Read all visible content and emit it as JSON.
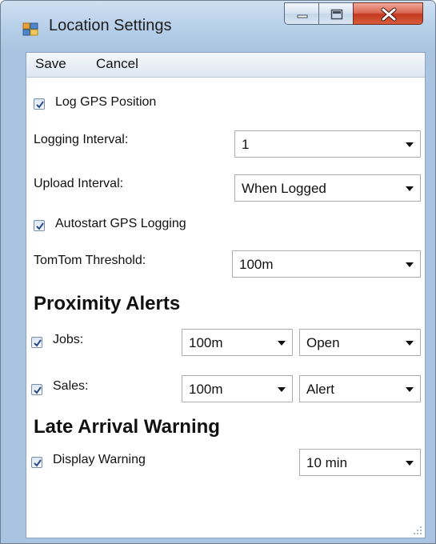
{
  "window": {
    "title": "Location Settings"
  },
  "menu": {
    "save": "Save",
    "cancel": "Cancel"
  },
  "form": {
    "log_gps": {
      "label": "Log GPS Position",
      "checked": true
    },
    "logging_interval": {
      "label": "Logging Interval:",
      "value": "1"
    },
    "upload_interval": {
      "label": "Upload Interval:",
      "value": "When Logged"
    },
    "autostart": {
      "label": "Autostart GPS Logging",
      "checked": true
    },
    "tomtom_threshold": {
      "label": "TomTom Threshold:",
      "value": "100m"
    },
    "proximity_heading": "Proximity Alerts",
    "jobs": {
      "label": "Jobs:",
      "checked": true,
      "distance": "100m",
      "action": "Open"
    },
    "sales": {
      "label": "Sales:",
      "checked": true,
      "distance": "100m",
      "action": "Alert"
    },
    "late_heading": "Late Arrival Warning",
    "display_warning": {
      "label": "Display Warning",
      "checked": true,
      "value": "10 min"
    }
  },
  "colors": {
    "close_button": "#c94a31",
    "frame": "#b9d1ea",
    "checkmark": "#2a4a8a"
  }
}
